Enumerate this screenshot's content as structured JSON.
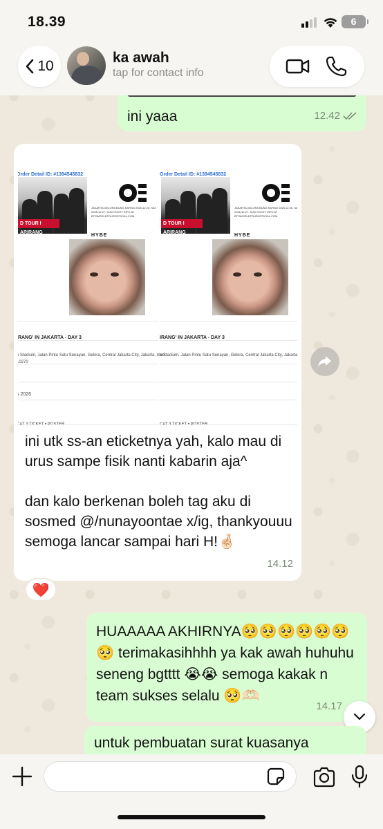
{
  "status_bar": {
    "time": "18.39",
    "battery": "6"
  },
  "header": {
    "back_count": "10",
    "contact_name": "ka awah",
    "contact_subtitle": "tap for contact info"
  },
  "messages": [
    {
      "direction": "out",
      "text": "ini yaaa",
      "time": "12.42"
    },
    {
      "direction": "in",
      "image": {
        "order_label": "Order Detail ID: #1394545832",
        "poster_banner": "D TOUR I ARIRANG",
        "venue_text": "JAKARTA GELORA BUNG KARNO 2026.12.26. SAT 2026.12.27. SUN TICKET INFO AT BTSWORLDTOUROFFICIAL.COM",
        "brand": "HYBE",
        "event_title": "IRANG' IN JAKARTA - DAY 3",
        "address": "n Stadium, Jalan Pintu Satu Senayan, Gelora, Central Jakarta City, Jakarta, Indo",
        "postal": "10270",
        "date_fragment": "s 2026",
        "ticket_type": "CAT 3 TICKET • POSTER"
      },
      "text": "ini utk ss-an eticketnya yah, kalo mau di urus sampe fisik nanti kabarin aja^\n\ndan kalo berkenan boleh tag aku di sosmed @/nunayoontae x/ig, thankyouuu semoga lancar sampai hari H!🤞🏻",
      "time": "14.12",
      "reaction": "❤️"
    },
    {
      "direction": "out",
      "text": "HUAAAAA AKHIRNYA🥺🥺🥺🥺🥺🥺🥺 terimakasihhhh ya kak awah huhuhu seneng bgtttt 😭😭 semoga kakak n team sukses selalu 🥺🫶🏻",
      "time": "14.17"
    },
    {
      "direction": "out",
      "text": "untuk pembuatan surat kuasanya"
    }
  ],
  "composer": {
    "placeholder": ""
  },
  "icons": {
    "back": "chevron-left-icon",
    "video": "video-camera-icon",
    "call": "phone-icon",
    "forward": "forward-arrow-icon",
    "scroll": "chevron-down-icon",
    "plus": "plus-icon",
    "sticker": "sticker-icon",
    "camera": "camera-icon",
    "mic": "microphone-icon"
  }
}
